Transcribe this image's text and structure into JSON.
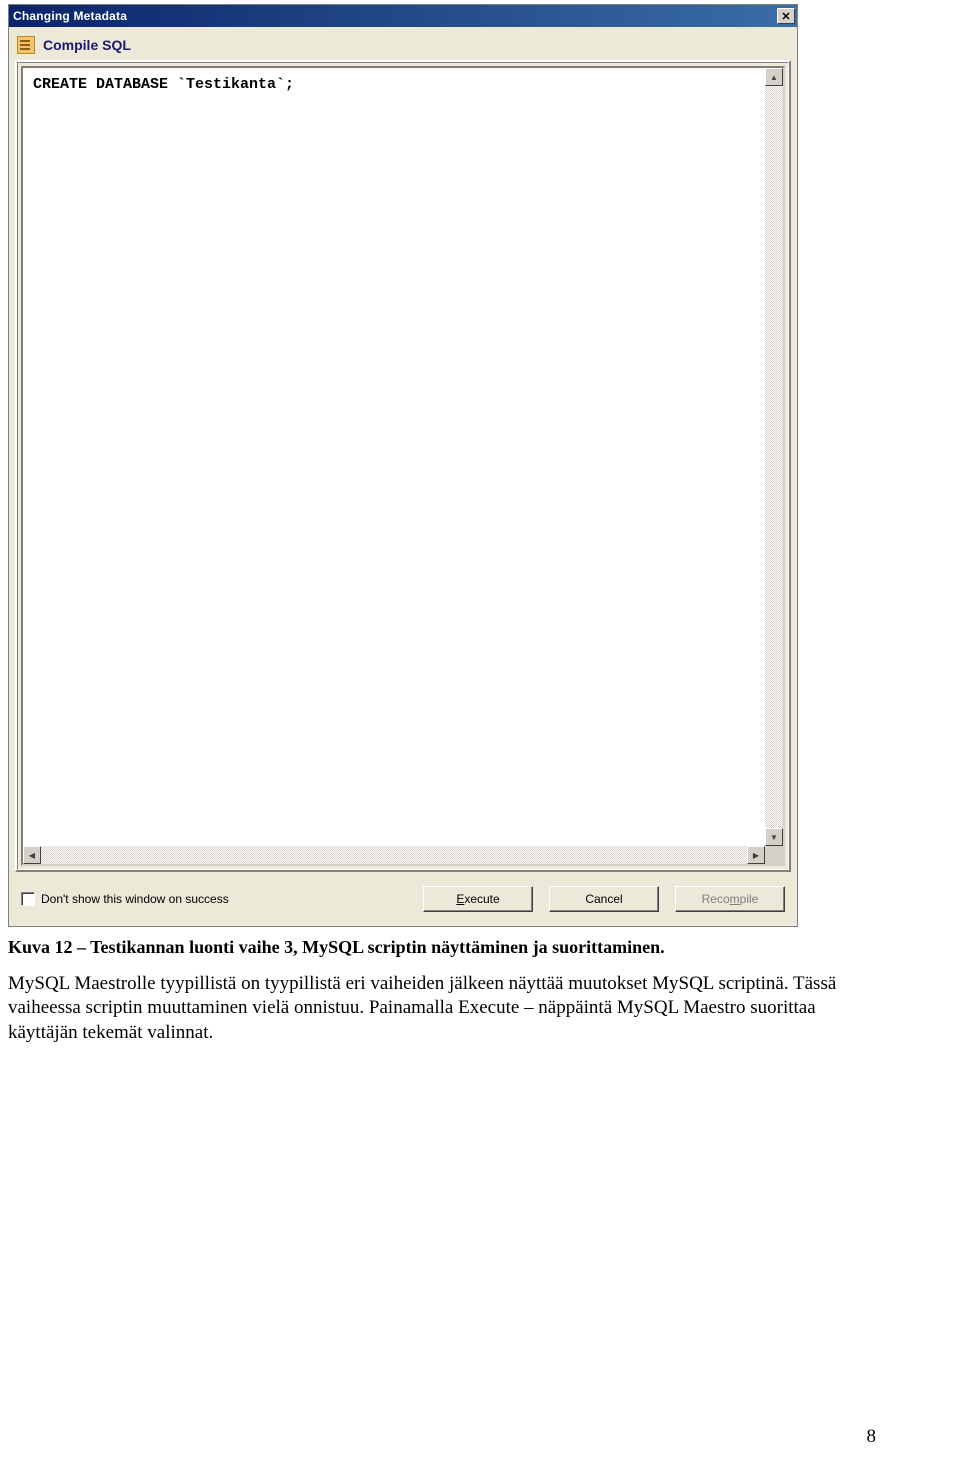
{
  "dialog": {
    "title": "Changing Metadata",
    "section_label": "Compile SQL",
    "code_line": "CREATE DATABASE `Testikanta`;",
    "checkbox_label": "Don't show this window on success",
    "buttons": {
      "execute": "Execute",
      "cancel": "Cancel",
      "recompile": "Recompile"
    }
  },
  "document": {
    "caption": "Kuva 12 – Testikannan luonti vaihe 3, MySQL scriptin näyttäminen ja suorittaminen.",
    "paragraph": "MySQL Maestrolle tyypillistä on tyypillistä eri vaiheiden jälkeen näyttää muutokset MySQL scriptinä. Tässä vaiheessa scriptin muuttaminen vielä onnistuu. Painamalla Execute – näppäintä MySQL Maestro suorittaa käyttäjän tekemät valinnat.",
    "page_number": "8"
  }
}
